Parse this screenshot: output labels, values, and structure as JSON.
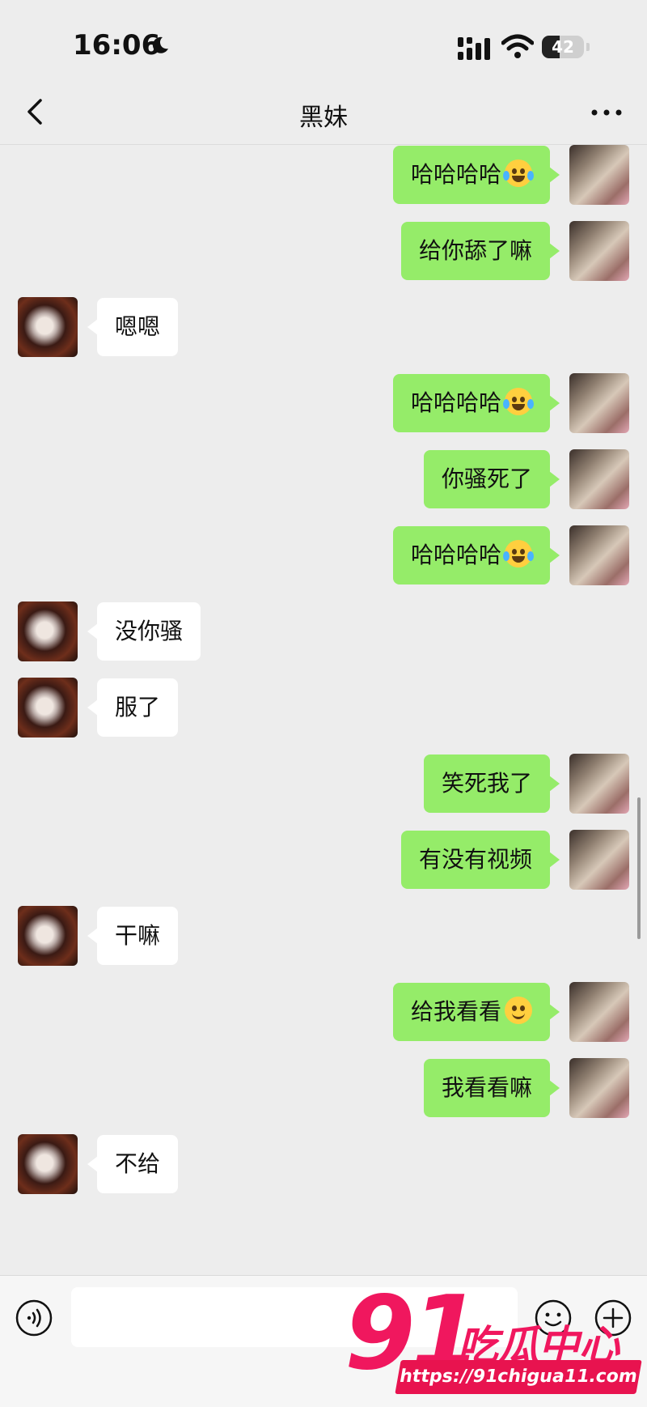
{
  "status_bar": {
    "time": "16:06",
    "battery": "42",
    "battery_level": 0.42
  },
  "nav": {
    "title": "黑妹"
  },
  "messages": [
    {
      "from": "me",
      "text": "哈哈哈哈",
      "emoji": "tears-of-joy"
    },
    {
      "from": "me",
      "text": "给你舔了嘛"
    },
    {
      "from": "them",
      "text": "嗯嗯"
    },
    {
      "from": "me",
      "text": "哈哈哈哈",
      "emoji": "tears-of-joy"
    },
    {
      "from": "me",
      "text": "你骚死了"
    },
    {
      "from": "me",
      "text": "哈哈哈哈",
      "emoji": "tears-of-joy"
    },
    {
      "from": "them",
      "text": "没你骚"
    },
    {
      "from": "them",
      "text": "服了"
    },
    {
      "from": "me",
      "text": "笑死我了"
    },
    {
      "from": "me",
      "text": "有没有视频"
    },
    {
      "from": "them",
      "text": "干嘛"
    },
    {
      "from": "me",
      "text": "给我看看",
      "emoji": "smile"
    },
    {
      "from": "me",
      "text": "我看看嘛"
    },
    {
      "from": "them",
      "text": "不给"
    }
  ],
  "input": {
    "placeholder": ""
  },
  "watermark": {
    "number": "91",
    "name": "吃瓜中心",
    "url": "https://91chigua11.com"
  },
  "colors": {
    "my_bubble": "#95ec69",
    "their_bubble": "#ffffff",
    "background": "#ededed",
    "watermark": "#f0175e"
  },
  "icons": [
    "back-icon",
    "more-icon",
    "voice-icon",
    "emoji-icon",
    "plus-icon"
  ]
}
